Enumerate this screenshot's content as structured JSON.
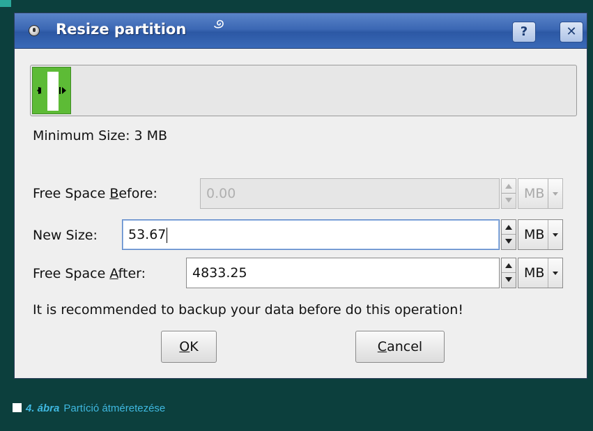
{
  "window": {
    "title": "Resize partition",
    "help_button": "?",
    "close_button": "✕"
  },
  "partition": {
    "min_size_label": "Minimum Size: 3 MB"
  },
  "fields": {
    "before": {
      "label_prefix": "Free Space ",
      "label_underline": "B",
      "label_suffix": "efore:",
      "value": "0.00",
      "unit": "MB",
      "enabled": false
    },
    "newsize": {
      "label": "New Size:",
      "value": "53.67",
      "unit": "MB",
      "enabled": true
    },
    "after": {
      "label_prefix": "Free Space ",
      "label_underline": "A",
      "label_suffix": "fter:",
      "value": "4833.25",
      "unit": "MB",
      "enabled": true
    }
  },
  "warning": "It is recommended to backup your data before do this operation!",
  "buttons": {
    "ok_underline": "O",
    "ok_rest": "K",
    "cancel_underline": "C",
    "cancel_rest": "ancel"
  },
  "caption": {
    "number": "4. ábra",
    "text": "Partíció átméretezése"
  },
  "colors": {
    "background": "#0c3f3d",
    "titlebar": "#3c68b4",
    "partition_fill": "#5dbb36",
    "caption_accent": "#3fb8e0"
  }
}
